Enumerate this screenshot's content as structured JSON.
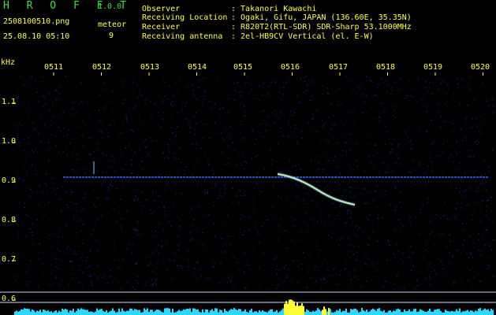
{
  "header": {
    "app_name": "H R O F F T",
    "version": "1.0.0",
    "filename": "2508100510.png",
    "datetime": "25.08.10 05:10",
    "meteor_label": "meteor",
    "meteor_count": "9",
    "info": [
      {
        "label": "Observer",
        "value": ": Takanori Kawachi"
      },
      {
        "label": "Receiving Location",
        "value": ": Ogaki, Gifu, JAPAN (136.60E, 35.35N)"
      },
      {
        "label": "Receiver",
        "value": ": R820T2(RTL-SDR) SDR-Sharp 53.1000MHz"
      },
      {
        "label": "Receiving antenna",
        "value": ": 2el-HB9CV Vertical (el. E-W)"
      }
    ]
  },
  "axes": {
    "y_unit": "kHz",
    "y_ticks": [
      "1.1",
      "1.0",
      "0.9",
      "0.8",
      "0.7",
      "0.6"
    ],
    "x_ticks": [
      "0511",
      "0512",
      "0513",
      "0514",
      "0515",
      "0516",
      "0517",
      "0518",
      "0519",
      "0520"
    ]
  },
  "colors": {
    "background": "#000000",
    "noise": "#1c24a0",
    "carrier": "#2f6cff",
    "echo_core": "#e8ffb0",
    "echo_glow": "#6fd0ff",
    "level_cyan": "#2cd8ff",
    "level_yellow": "#ffff33",
    "green_text": "#35e035",
    "yellow_text": "#ffff3c"
  }
}
